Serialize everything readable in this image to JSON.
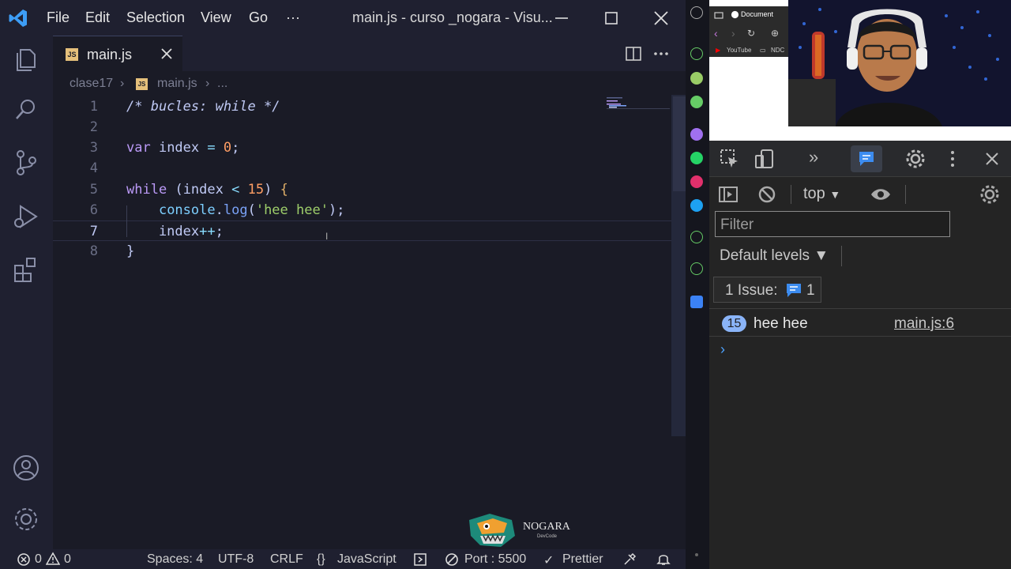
{
  "vscode": {
    "menu": [
      "File",
      "Edit",
      "Selection",
      "View",
      "Go",
      "···"
    ],
    "window_title": "main.js - curso _nogara - Visu...",
    "tab": {
      "name": "main.js",
      "icon": "JS"
    },
    "breadcrumb": {
      "folder": "clase17",
      "file": "main.js",
      "more": "..."
    },
    "code_lines": [
      {
        "num": "1",
        "text": "/* bucles: while */"
      },
      {
        "num": "2",
        "text": ""
      },
      {
        "num": "3",
        "text": "var index = 0;"
      },
      {
        "num": "4",
        "text": ""
      },
      {
        "num": "5",
        "text": "while (index < 15) {"
      },
      {
        "num": "6",
        "text": "    console.log('hee hee');"
      },
      {
        "num": "7",
        "text": "    index++;"
      },
      {
        "num": "8",
        "text": "}"
      }
    ],
    "watermark": {
      "name": "NOGARA",
      "sub": "DevCode"
    },
    "status": {
      "errors": "0",
      "warnings": "0",
      "spaces": "Spaces: 4",
      "encoding": "UTF-8",
      "eol": "CRLF",
      "language": "JavaScript",
      "language_icon": "{}",
      "port": "Port : 5500",
      "prettier": "Prettier"
    }
  },
  "browser": {
    "tab_title": "Document",
    "bookmarks": [
      "YouTube",
      "NDC"
    ]
  },
  "devtools": {
    "context": "top",
    "filter_placeholder": "Filter",
    "levels": "Default levels ▼",
    "issues_label": "1 Issue:",
    "issues_count": "1",
    "message": {
      "count": "15",
      "text": "hee hee",
      "source": "main.js:6"
    },
    "prompt": "›"
  },
  "colors": {
    "editor_bg": "#1a1b26",
    "chrome_bg": "#1f2030",
    "keyword": "#bb9af7",
    "number": "#ff9e64",
    "string": "#9ece6a",
    "devtools_bg": "#242424",
    "badge": "#8ab4f8"
  }
}
